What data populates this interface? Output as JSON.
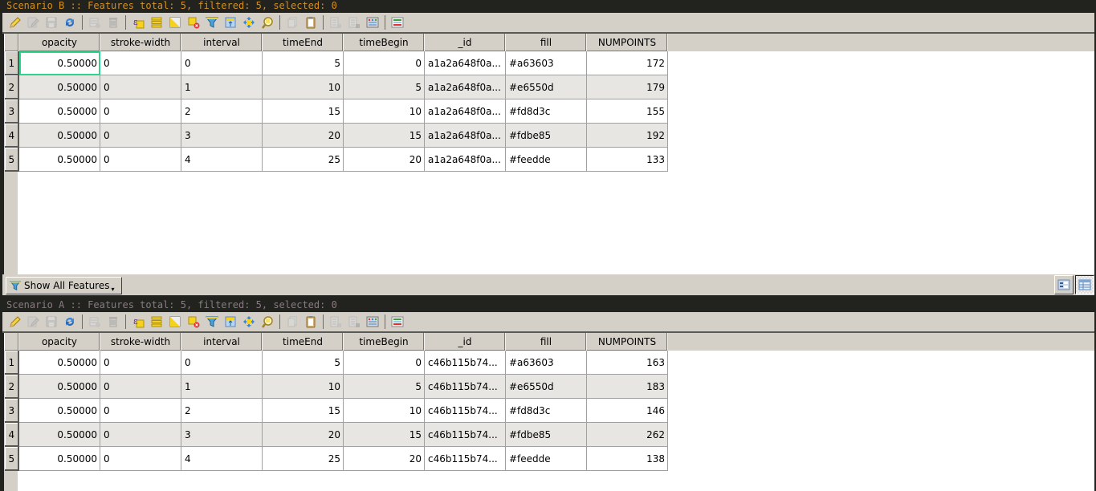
{
  "toolbar_buttons": [
    {
      "name": "toggle-editing-icon",
      "enabled": true
    },
    {
      "name": "toggle-multi-edit-icon",
      "enabled": false
    },
    {
      "name": "save-edits-icon",
      "enabled": false
    },
    {
      "name": "reload-table-icon",
      "enabled": true
    },
    {
      "sep": true
    },
    {
      "name": "add-feature-icon",
      "enabled": false
    },
    {
      "name": "delete-features-icon",
      "enabled": false
    },
    {
      "sep": true
    },
    {
      "name": "select-by-expression-icon",
      "enabled": true
    },
    {
      "name": "select-all-icon",
      "enabled": true
    },
    {
      "name": "invert-selection-icon",
      "enabled": true
    },
    {
      "name": "deselect-all-icon",
      "enabled": true
    },
    {
      "name": "filter-select-features-icon",
      "enabled": true
    },
    {
      "name": "move-selection-to-top-icon",
      "enabled": true
    },
    {
      "name": "pan-to-selected-icon",
      "enabled": true
    },
    {
      "name": "zoom-to-selected-icon",
      "enabled": true
    },
    {
      "sep": true
    },
    {
      "name": "copy-rows-icon",
      "enabled": false
    },
    {
      "name": "paste-features-icon",
      "enabled": true
    },
    {
      "sep": true
    },
    {
      "name": "new-field-icon",
      "enabled": false
    },
    {
      "name": "delete-field-icon",
      "enabled": false
    },
    {
      "name": "field-calculator-icon",
      "enabled": true
    },
    {
      "sep": true
    },
    {
      "name": "conditional-formatting-icon",
      "enabled": true
    }
  ],
  "columns": [
    "opacity",
    "stroke-width",
    "interval",
    "timeEnd",
    "timeBegin",
    "_id",
    "fill",
    "NUMPOINTS"
  ],
  "numeric_columns": [
    true,
    false,
    false,
    true,
    true,
    false,
    false,
    true
  ],
  "panels": [
    {
      "key": "scenario_b",
      "title": "Scenario B :: Features total: 5, filtered: 5, selected: 0",
      "active": true,
      "filter_label": "Show All Features",
      "rows": [
        {
          "n": "1",
          "cells": [
            "0.50000",
            "0",
            "0",
            "5",
            "0",
            "a1a2a648f0a...",
            "#a63603",
            "172"
          ]
        },
        {
          "n": "2",
          "cells": [
            "0.50000",
            "0",
            "1",
            "10",
            "5",
            "a1a2a648f0a...",
            "#e6550d",
            "179"
          ]
        },
        {
          "n": "3",
          "cells": [
            "0.50000",
            "0",
            "2",
            "15",
            "10",
            "a1a2a648f0a...",
            "#fd8d3c",
            "155"
          ]
        },
        {
          "n": "4",
          "cells": [
            "0.50000",
            "0",
            "3",
            "20",
            "15",
            "a1a2a648f0a...",
            "#fdbe85",
            "192"
          ]
        },
        {
          "n": "5",
          "cells": [
            "0.50000",
            "0",
            "4",
            "25",
            "20",
            "a1a2a648f0a...",
            "#feedde",
            "133"
          ]
        }
      ]
    },
    {
      "key": "scenario_a",
      "title": "Scenario A :: Features total: 5, filtered: 5, selected: 0",
      "active": false,
      "rows": [
        {
          "n": "1",
          "cells": [
            "0.50000",
            "0",
            "0",
            "5",
            "0",
            "c46b115b74...",
            "#a63603",
            "163"
          ]
        },
        {
          "n": "2",
          "cells": [
            "0.50000",
            "0",
            "1",
            "10",
            "5",
            "c46b115b74...",
            "#e6550d",
            "183"
          ]
        },
        {
          "n": "3",
          "cells": [
            "0.50000",
            "0",
            "2",
            "15",
            "10",
            "c46b115b74...",
            "#fd8d3c",
            "146"
          ]
        },
        {
          "n": "4",
          "cells": [
            "0.50000",
            "0",
            "3",
            "20",
            "15",
            "c46b115b74...",
            "#fdbe85",
            "262"
          ]
        },
        {
          "n": "5",
          "cells": [
            "0.50000",
            "0",
            "4",
            "25",
            "20",
            "c46b115b74...",
            "#feedde",
            "138"
          ]
        }
      ]
    }
  ],
  "colors": {
    "active_title": "#d48f1c",
    "inactive_title": "#8a7b85",
    "current_cell_outline": "#2fd58a"
  }
}
